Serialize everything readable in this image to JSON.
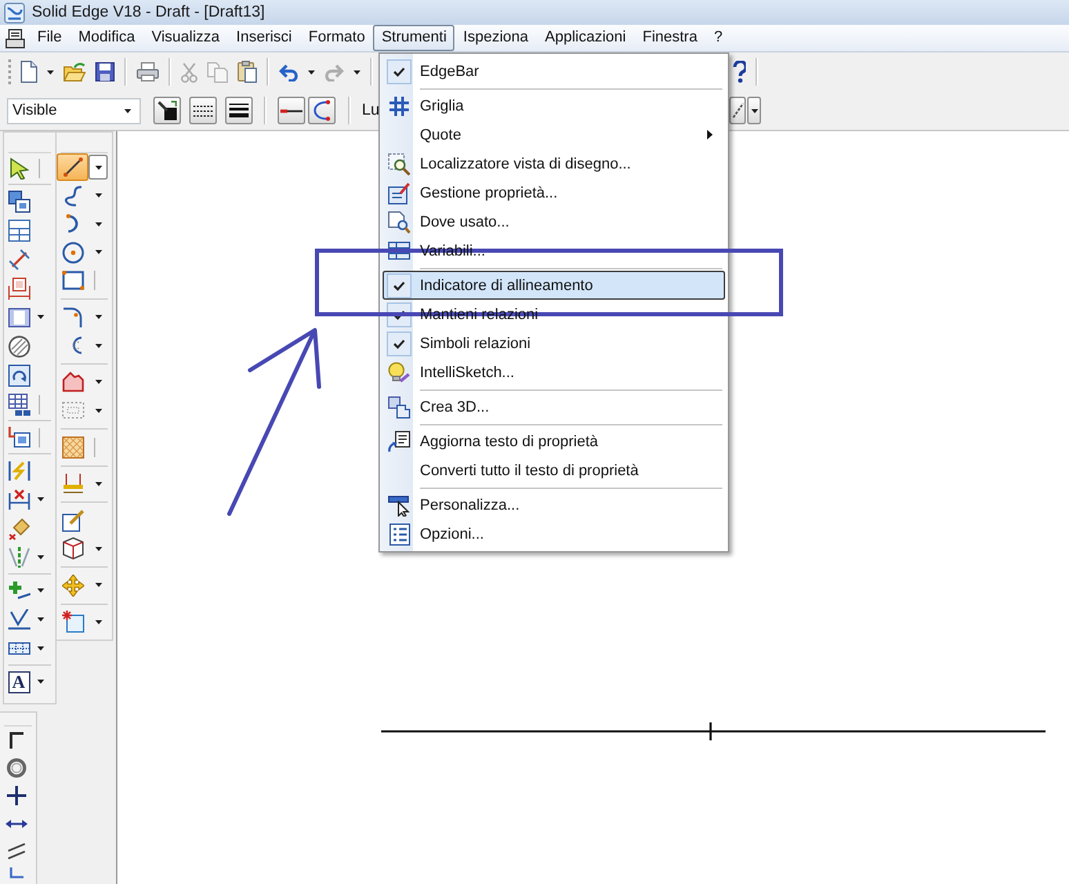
{
  "window": {
    "title": "Solid Edge V18 - Draft - [Draft13]"
  },
  "menu_bar": {
    "items": [
      {
        "label": "File",
        "selected": false
      },
      {
        "label": "Modifica",
        "selected": false
      },
      {
        "label": "Visualizza",
        "selected": false
      },
      {
        "label": "Inserisci",
        "selected": false
      },
      {
        "label": "Formato",
        "selected": false
      },
      {
        "label": "Strumenti",
        "selected": true
      },
      {
        "label": "Ispeziona",
        "selected": false
      },
      {
        "label": "Applicazioni",
        "selected": false
      },
      {
        "label": "Finestra",
        "selected": false
      },
      {
        "label": "?",
        "selected": false
      }
    ]
  },
  "standard_toolbar": {
    "cut": {
      "disabled": true
    },
    "copy": {
      "disabled": true
    },
    "paste": {
      "disabled": false
    },
    "undo": {
      "disabled": false
    },
    "redo": {
      "disabled": true
    }
  },
  "format_toolbar": {
    "style_dropdown": {
      "value": "Visible"
    },
    "field_label": "Lu"
  },
  "left_toolbar": {
    "text_tool_label": "A"
  },
  "sketch_tools": [
    {
      "selected": true
    },
    {
      "selected": false
    },
    {
      "selected": false
    },
    {
      "selected": false
    },
    {
      "selected": false
    },
    {
      "selected": false
    },
    {
      "selected": false
    },
    {
      "selected": false
    },
    {
      "selected": false
    },
    {
      "selected": false
    },
    {
      "selected": false
    },
    {
      "selected": false
    },
    {
      "selected": false
    },
    {
      "selected": false
    },
    {
      "selected": false
    }
  ],
  "tools_menu": {
    "groups": [
      {
        "items": [
          {
            "label": "EdgeBar",
            "kind": "command",
            "checked": true,
            "selected": false
          }
        ]
      },
      {
        "items": [
          {
            "label": "Griglia",
            "kind": "command",
            "checked": false,
            "selected": false
          },
          {
            "label": "Quote",
            "kind": "submenu",
            "checked": false,
            "selected": false
          },
          {
            "label": "Localizzatore vista di disegno...",
            "kind": "command",
            "checked": false,
            "selected": false
          },
          {
            "label": "Gestione proprietà...",
            "kind": "command",
            "checked": false,
            "selected": false
          },
          {
            "label": "Dove usato...",
            "kind": "command",
            "checked": false,
            "selected": false
          },
          {
            "label": "Variabili...",
            "kind": "command",
            "checked": false,
            "selected": false
          }
        ]
      },
      {
        "items": [
          {
            "label": "Indicatore di allineamento",
            "kind": "command",
            "checked": true,
            "selected": true
          },
          {
            "label": "Mantieni relazioni",
            "kind": "command",
            "checked": true,
            "selected": false
          },
          {
            "label": "Simboli relazioni",
            "kind": "command",
            "checked": true,
            "selected": false
          },
          {
            "label": "IntelliSketch...",
            "kind": "command",
            "checked": false,
            "selected": false
          }
        ]
      },
      {
        "items": [
          {
            "label": "Crea 3D...",
            "kind": "command",
            "checked": false,
            "selected": false
          }
        ]
      },
      {
        "items": [
          {
            "label": "Aggiorna testo di proprietà",
            "kind": "command",
            "checked": false,
            "selected": false
          },
          {
            "label": "Converti tutto il testo di proprietà",
            "kind": "command",
            "checked": false,
            "selected": false
          }
        ]
      },
      {
        "items": [
          {
            "label": "Personalizza...",
            "kind": "command",
            "checked": false,
            "selected": false
          },
          {
            "label": "Opzioni...",
            "kind": "command",
            "checked": false,
            "selected": false
          }
        ]
      }
    ]
  }
}
